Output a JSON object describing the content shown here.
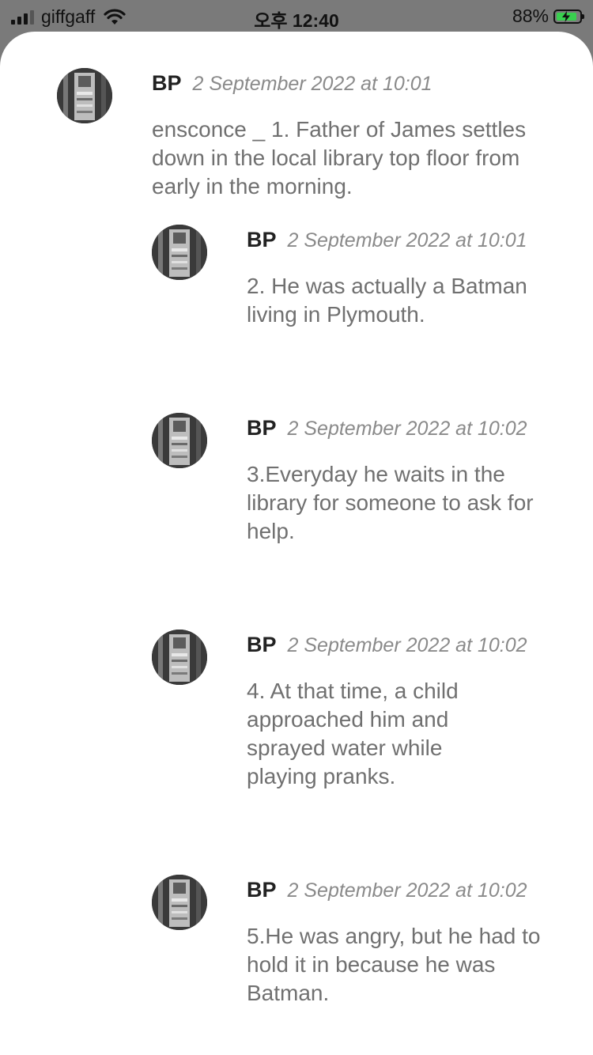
{
  "status_bar": {
    "carrier": "giffgaff",
    "time": "오후 12:40",
    "battery": "88%",
    "battery_level": 0.88
  },
  "comments": [
    {
      "author": "BP",
      "date": "2 September 2022 at 10:01",
      "text": "ensconce _ 1. Father of James settles down in the local library top floor from early in the morning."
    },
    {
      "author": "BP",
      "date": "2 September 2022 at 10:01",
      "text": "2. He was actually a Batman living in Plymouth."
    },
    {
      "author": "BP",
      "date": "2 September 2022 at 10:02",
      "text": "3.Everyday he waits in the library for someone to ask for help."
    },
    {
      "author": "BP",
      "date": "2 September 2022 at 10:02",
      "text": "4. At that time, a child approached him and sprayed water while playing pranks."
    },
    {
      "author": "BP",
      "date": "2 September 2022 at 10:02",
      "text": "5.He was angry, but he had to hold it in because he was Batman."
    }
  ]
}
